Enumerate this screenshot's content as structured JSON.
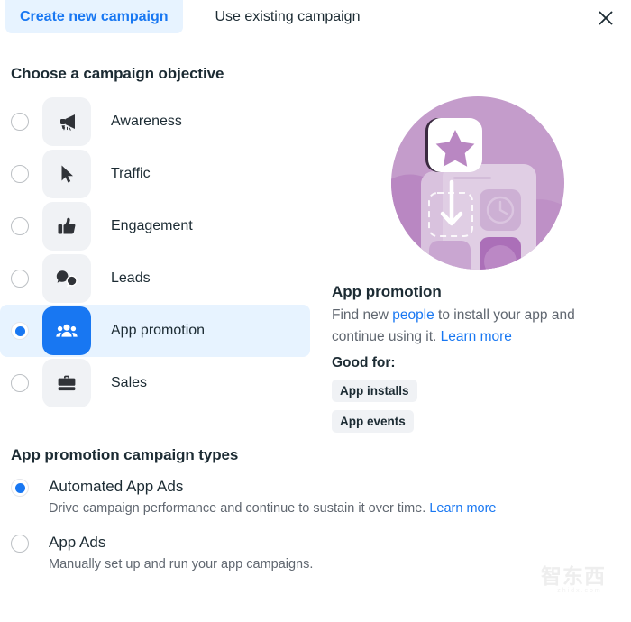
{
  "tabs": [
    {
      "label": "Create new campaign",
      "active": true
    },
    {
      "label": "Use existing campaign",
      "active": false
    }
  ],
  "close_label": "close-icon",
  "objective_section": {
    "heading": "Choose a campaign objective",
    "options": [
      {
        "label": "Awareness",
        "icon": "megaphone-icon",
        "selected": false
      },
      {
        "label": "Traffic",
        "icon": "cursor-icon",
        "selected": false
      },
      {
        "label": "Engagement",
        "icon": "thumbs-up-icon",
        "selected": false
      },
      {
        "label": "Leads",
        "icon": "chat-bubbles-icon",
        "selected": false
      },
      {
        "label": "App promotion",
        "icon": "people-group-icon",
        "selected": true
      },
      {
        "label": "Sales",
        "icon": "briefcase-icon",
        "selected": false
      }
    ]
  },
  "detail": {
    "illustration": "app-promotion-illustration",
    "title": "App promotion",
    "desc_part1": "Find new ",
    "desc_link1": "people",
    "desc_part2": " to install your app and continue using it. ",
    "desc_link2": "Learn more",
    "good_for_label": "Good for:",
    "tags": [
      "App installs",
      "App events"
    ]
  },
  "campaign_types": {
    "heading": "App promotion campaign types",
    "options": [
      {
        "title": "Automated App Ads",
        "desc": "Drive campaign performance and continue to sustain it over time. ",
        "link": "Learn more",
        "selected": true
      },
      {
        "title": "App Ads",
        "desc": "Manually set up and run your app campaigns.",
        "link": "",
        "selected": false
      }
    ]
  },
  "watermark": {
    "top": "智东西",
    "bottom": "zhidx.com"
  },
  "colors": {
    "accent": "#1877f2",
    "accent_bg": "#e7f3ff",
    "icon_bg": "#f0f2f5",
    "text": "#1c2b33",
    "muted": "#606770"
  }
}
